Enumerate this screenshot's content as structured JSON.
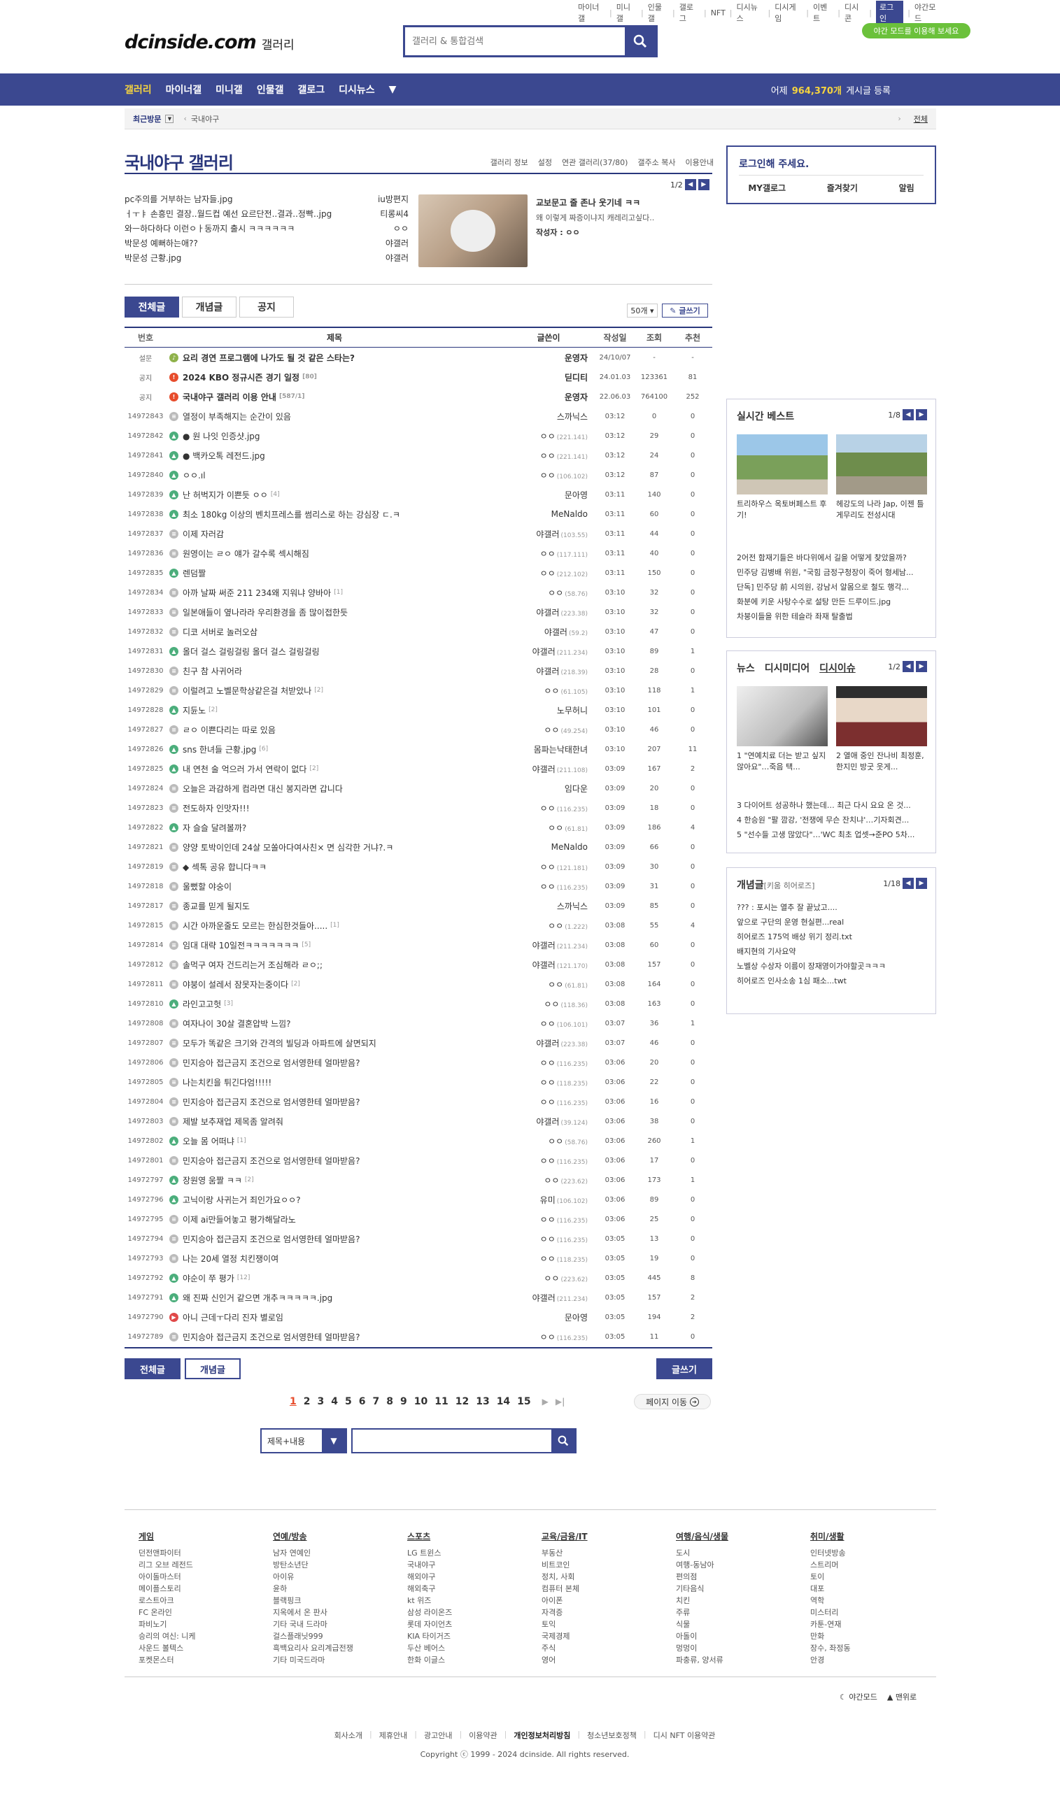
{
  "top_links": [
    "마이너갤",
    "미니갤",
    "인물갤",
    "갤로그",
    "NFT",
    "디시뉴스",
    "디시게임",
    "이벤트",
    "디시콘",
    "로그인",
    "야간모드"
  ],
  "night_banner": "야간 모드를 이용해 보세요",
  "logo": {
    "wordmark": "dcinside.com",
    "gallery": "갤러리"
  },
  "search": {
    "placeholder": "갤러리 & 통합검색"
  },
  "gnb": {
    "items": [
      "갤러리",
      "마이너갤",
      "미니갤",
      "인물갤",
      "갤로그",
      "디시뉴스"
    ],
    "count_prefix": "어제",
    "count_value": "964,370개",
    "count_suffix": "게시글 등록"
  },
  "visit": {
    "label": "최근방문",
    "current": "국내야구",
    "all": "전체"
  },
  "gallery": {
    "title": "국내야구 갤러리",
    "menu": [
      "갤러리 정보",
      "설정",
      "연관 갤러리(37/80)",
      "갤주소 복사",
      "이용안내"
    ]
  },
  "hot": {
    "page": "1/2",
    "rows": [
      {
        "title": "pc주의를 거부하는 남자들.jpg",
        "writer": "iu방편지"
      },
      {
        "title": "ㅓㅜㅑ 손흥민 결장..월드컵 예선 요르단전..결과..정빡..jpg",
        "writer": "티롱씨4"
      },
      {
        "title": "와ㅡ하다하다 이런ㅇㅏ동까지 출시 ㅋㅋㅋㅋㅋㅋ",
        "writer": "ㅇㅇ"
      },
      {
        "title": "박문성 예뻐하는애??",
        "writer": "야갤러"
      },
      {
        "title": "박문성 근황.jpg",
        "writer": "야갤러"
      }
    ],
    "featured_title": "교보문고 줄 존나 웃기네 ㅋㅋ",
    "featured_sub": "왜 이렇게 짜증이냐지 캐레리고싶다..",
    "featured_writer": "작성자 : ㅇㅇ"
  },
  "tabs": [
    "전체글",
    "개념글",
    "공지"
  ],
  "list_ctrl": {
    "per_page": "50개",
    "write": "글쓰기"
  },
  "table_head": [
    "번호",
    "제목",
    "글쓴이",
    "작성일",
    "조회",
    "추천"
  ],
  "posts": [
    {
      "num": "설문",
      "icon": "speaker",
      "title": "요리 경연 프로그램에 나가도 될 것 같은 스타는?",
      "cmt": "",
      "writer": "운영자",
      "ip": "",
      "date": "24/10/07",
      "views": "-",
      "rec": "-",
      "notice": true
    },
    {
      "num": "공지",
      "icon": "notice",
      "title": "2024 KBO 정규시즌 경기 일정",
      "cmt": "[80]",
      "writer": "딛디티",
      "ip": "",
      "date": "24.01.03",
      "views": "123361",
      "rec": "81",
      "notice": true
    },
    {
      "num": "공지",
      "icon": "notice",
      "title": "국내야구 갤러리 이용 안내",
      "cmt": "[587/1]",
      "writer": "운영자",
      "ip": "",
      "date": "22.06.03",
      "views": "764100",
      "rec": "252",
      "notice": true
    },
    {
      "num": "14972843",
      "icon": "txt",
      "title": "열정이 부족해지는 순간이 있음",
      "cmt": "",
      "writer": "스까닉스",
      "ip": "",
      "date": "03:12",
      "views": "0",
      "rec": "0"
    },
    {
      "num": "14972842",
      "icon": "img",
      "title": "● 원 나잇 인증샷.jpg",
      "cmt": "",
      "writer": "ㅇㅇ",
      "ip": "(221.141)",
      "date": "03:12",
      "views": "29",
      "rec": "0"
    },
    {
      "num": "14972841",
      "icon": "img",
      "title": "● 백카오톡 레전드.jpg",
      "cmt": "",
      "writer": "ㅇㅇ",
      "ip": "(221.141)",
      "date": "03:12",
      "views": "24",
      "rec": "0"
    },
    {
      "num": "14972840",
      "icon": "img",
      "title": "ㅇㅇ.ıl",
      "cmt": "",
      "writer": "ㅇㅇ",
      "ip": "(106.102)",
      "date": "03:12",
      "views": "87",
      "rec": "0"
    },
    {
      "num": "14972839",
      "icon": "img",
      "title": "난 허벅지가 이쁜듯 ㅇㅇ",
      "cmt": "[4]",
      "writer": "문아영",
      "ip": "",
      "date": "03:11",
      "views": "140",
      "rec": "0"
    },
    {
      "num": "14972838",
      "icon": "img",
      "title": "최소 180kg 이상의 벤치프레스를 썸리스로 하는 강심장 ㄷ.ㅋ",
      "cmt": "",
      "writer": "MeNaldo",
      "ip": "",
      "date": "03:11",
      "views": "60",
      "rec": "0"
    },
    {
      "num": "14972837",
      "icon": "txt",
      "title": "이제 자러감",
      "cmt": "",
      "writer": "야갤러",
      "ip": "(103.55)",
      "date": "03:11",
      "views": "44",
      "rec": "0"
    },
    {
      "num": "14972836",
      "icon": "txt",
      "title": "원영이는 ㄹㅇ 얘가 갈수록 섹시해짐",
      "cmt": "",
      "writer": "ㅇㅇ",
      "ip": "(117.111)",
      "date": "03:11",
      "views": "40",
      "rec": "0"
    },
    {
      "num": "14972835",
      "icon": "img",
      "title": "렌덤짤",
      "cmt": "",
      "writer": "ㅇㅇ",
      "ip": "(212.102)",
      "date": "03:11",
      "views": "150",
      "rec": "0"
    },
    {
      "num": "14972834",
      "icon": "txt",
      "title": "아까 날짜 써준 211 234왜 지워냐 양바아",
      "cmt": "[1]",
      "writer": "ㅇㅇ",
      "ip": "(58.76)",
      "date": "03:10",
      "views": "32",
      "rec": "0"
    },
    {
      "num": "14972833",
      "icon": "txt",
      "title": "일본애들이 옆나라라 우리환경을 좀 많이접한듯",
      "cmt": "",
      "writer": "야갤러",
      "ip": "(223.38)",
      "date": "03:10",
      "views": "32",
      "rec": "0"
    },
    {
      "num": "14972832",
      "icon": "txt",
      "title": "디코 서버로 놀러오삼",
      "cmt": "",
      "writer": "야갤러",
      "ip": "(59.2)",
      "date": "03:10",
      "views": "47",
      "rec": "0"
    },
    {
      "num": "14972831",
      "icon": "img",
      "title": "올더 걸스 걸링걸링 올더 걸스 걸링걸링",
      "cmt": "",
      "writer": "야갤러",
      "ip": "(211.234)",
      "date": "03:10",
      "views": "89",
      "rec": "1"
    },
    {
      "num": "14972830",
      "icon": "txt",
      "title": "친구 참 사귀어라",
      "cmt": "",
      "writer": "야갤러",
      "ip": "(218.39)",
      "date": "03:10",
      "views": "28",
      "rec": "0"
    },
    {
      "num": "14972829",
      "icon": "txt",
      "title": "이럴려고 노벨문학상같은걸 처받았나",
      "cmt": "[2]",
      "writer": "ㅇㅇ",
      "ip": "(61.105)",
      "date": "03:10",
      "views": "118",
      "rec": "1"
    },
    {
      "num": "14972828",
      "icon": "img",
      "title": "지듄노",
      "cmt": "[2]",
      "writer": "노무허니",
      "ip": "",
      "date": "03:10",
      "views": "101",
      "rec": "0"
    },
    {
      "num": "14972827",
      "icon": "txt",
      "title": "ㄹㅇ 이쁜다리는 따로 있음",
      "cmt": "",
      "writer": "ㅇㅇ",
      "ip": "(49.254)",
      "date": "03:10",
      "views": "46",
      "rec": "0"
    },
    {
      "num": "14972826",
      "icon": "img",
      "title": "sns 한녀들 근황.jpg",
      "cmt": "[6]",
      "writer": "몸파는낙태한녀",
      "ip": "",
      "date": "03:10",
      "views": "207",
      "rec": "11"
    },
    {
      "num": "14972825",
      "icon": "img",
      "title": "내 연천 술 억으러 가서 연락이 없다",
      "cmt": "[2]",
      "writer": "야갤러",
      "ip": "(211.108)",
      "date": "03:09",
      "views": "167",
      "rec": "2"
    },
    {
      "num": "14972824",
      "icon": "txt",
      "title": "오늘은 과감하게 컴라면 대신 봉지라면 갑니다",
      "cmt": "",
      "writer": "임다운",
      "ip": "",
      "date": "03:09",
      "views": "20",
      "rec": "0"
    },
    {
      "num": "14972823",
      "icon": "txt",
      "title": "전도하자 인맛자!!!",
      "cmt": "",
      "writer": "ㅇㅇ",
      "ip": "(116.235)",
      "date": "03:09",
      "views": "18",
      "rec": "0"
    },
    {
      "num": "14972822",
      "icon": "img",
      "title": "자 슬슬 달려볼까?",
      "cmt": "",
      "writer": "ㅇㅇ",
      "ip": "(61.81)",
      "date": "03:09",
      "views": "186",
      "rec": "4"
    },
    {
      "num": "14972821",
      "icon": "txt",
      "title": "양양 토박이인데 24살 모쏠아다여사친× 면 심각한 거냐?.ㅋ",
      "cmt": "",
      "writer": "MeNaldo",
      "ip": "",
      "date": "03:09",
      "views": "66",
      "rec": "0"
    },
    {
      "num": "14972819",
      "icon": "txt",
      "title": "◆ 섹톡 공유 합니다ㅋㅋ",
      "cmt": "",
      "writer": "ㅇㅇ",
      "ip": "(121.181)",
      "date": "03:09",
      "views": "30",
      "rec": "0"
    },
    {
      "num": "14972818",
      "icon": "txt",
      "title": "울뻤할 야숭이",
      "cmt": "",
      "writer": "ㅇㅇ",
      "ip": "(116.235)",
      "date": "03:09",
      "views": "31",
      "rec": "0"
    },
    {
      "num": "14972817",
      "icon": "txt",
      "title": "종교를 믿게 될지도",
      "cmt": "",
      "writer": "스까닉스",
      "ip": "",
      "date": "03:09",
      "views": "85",
      "rec": "0"
    },
    {
      "num": "14972815",
      "icon": "txt",
      "title": "시간 아까운줄도 모르는 한심한것들아.....",
      "cmt": "[1]",
      "writer": "ㅇㅇ",
      "ip": "(1.222)",
      "date": "03:08",
      "views": "55",
      "rec": "4"
    },
    {
      "num": "14972814",
      "icon": "txt",
      "title": "임대 대략 10일전ㅋㅋㅋㅋㅋㅋㅋ",
      "cmt": "[5]",
      "writer": "야갤러",
      "ip": "(211.234)",
      "date": "03:08",
      "views": "60",
      "rec": "0"
    },
    {
      "num": "14972812",
      "icon": "txt",
      "title": "솔먹구 여자 건드리는거 조심해라 ㄹㅇ;;",
      "cmt": "",
      "writer": "야갤러",
      "ip": "(121.170)",
      "date": "03:08",
      "views": "157",
      "rec": "0"
    },
    {
      "num": "14972811",
      "icon": "txt",
      "title": "야붕이 설레서 잠못자는중이다",
      "cmt": "[2]",
      "writer": "ㅇㅇ",
      "ip": "(61.81)",
      "date": "03:08",
      "views": "164",
      "rec": "0"
    },
    {
      "num": "14972810",
      "icon": "img",
      "title": "라인고고헛",
      "cmt": "[3]",
      "writer": "ㅇㅇ",
      "ip": "(118.36)",
      "date": "03:08",
      "views": "163",
      "rec": "0"
    },
    {
      "num": "14972808",
      "icon": "txt",
      "title": "여자나이 30살 결혼압박 느낌?",
      "cmt": "",
      "writer": "ㅇㅇ",
      "ip": "(106.101)",
      "date": "03:07",
      "views": "36",
      "rec": "1"
    },
    {
      "num": "14972807",
      "icon": "txt",
      "title": "모두가 똑같은 크기와 간격의 빌딩과 아파트에 살면되지",
      "cmt": "",
      "writer": "야갤러",
      "ip": "(223.38)",
      "date": "03:07",
      "views": "46",
      "rec": "0"
    },
    {
      "num": "14972806",
      "icon": "txt",
      "title": "민지승아 접근금지 조건으로 엄서영한테 얼마받음?",
      "cmt": "",
      "writer": "ㅇㅇ",
      "ip": "(116.235)",
      "date": "03:06",
      "views": "20",
      "rec": "0"
    },
    {
      "num": "14972805",
      "icon": "txt",
      "title": "나는치킨을 튀긴다엄!!!!!",
      "cmt": "",
      "writer": "ㅇㅇ",
      "ip": "(118.235)",
      "date": "03:06",
      "views": "22",
      "rec": "0"
    },
    {
      "num": "14972804",
      "icon": "txt",
      "title": "민지승아 접근금지 조건으로 엄서영한테 얼마받음?",
      "cmt": "",
      "writer": "ㅇㅇ",
      "ip": "(116.235)",
      "date": "03:06",
      "views": "16",
      "rec": "0"
    },
    {
      "num": "14972803",
      "icon": "txt",
      "title": "제발 보추재업 제목좀 알려줘",
      "cmt": "",
      "writer": "야갤러",
      "ip": "(39.124)",
      "date": "03:06",
      "views": "38",
      "rec": "0"
    },
    {
      "num": "14972802",
      "icon": "img",
      "title": "오늘 몸 어떠냐",
      "cmt": "[1]",
      "writer": "ㅇㅇ",
      "ip": "(58.76)",
      "date": "03:06",
      "views": "260",
      "rec": "1"
    },
    {
      "num": "14972801",
      "icon": "txt",
      "title": "민지승아 접근금지 조건으로 엄서영한테 얼마받음?",
      "cmt": "",
      "writer": "ㅇㅇ",
      "ip": "(116.235)",
      "date": "03:06",
      "views": "17",
      "rec": "0"
    },
    {
      "num": "14972797",
      "icon": "img",
      "title": "장원영 움짤 ㅋㅋ",
      "cmt": "[2]",
      "writer": "ㅇㅇ",
      "ip": "(223.62)",
      "date": "03:06",
      "views": "173",
      "rec": "1"
    },
    {
      "num": "14972796",
      "icon": "img",
      "title": "고닉이랑 사귀는거 죄인가요ㅇㅇ?",
      "cmt": "",
      "writer": "유미",
      "ip": "(106.102)",
      "date": "03:06",
      "views": "89",
      "rec": "0"
    },
    {
      "num": "14972795",
      "icon": "txt",
      "title": "이제 ai만들어놓고 평가해달라노",
      "cmt": "",
      "writer": "ㅇㅇ",
      "ip": "(116.235)",
      "date": "03:06",
      "views": "25",
      "rec": "0"
    },
    {
      "num": "14972794",
      "icon": "txt",
      "title": "민지승아 접근금지 조건으로 엄서영한테 얼마받음?",
      "cmt": "",
      "writer": "ㅇㅇ",
      "ip": "(116.235)",
      "date": "03:05",
      "views": "13",
      "rec": "0"
    },
    {
      "num": "14972793",
      "icon": "txt",
      "title": "나는 20세 열정 치킨쟁이여",
      "cmt": "",
      "writer": "ㅇㅇ",
      "ip": "(118.235)",
      "date": "03:05",
      "views": "19",
      "rec": "0"
    },
    {
      "num": "14972792",
      "icon": "img",
      "title": "야순이 쭈 평가",
      "cmt": "[12]",
      "writer": "ㅇㅇ",
      "ip": "(223.62)",
      "date": "03:05",
      "views": "445",
      "rec": "8"
    },
    {
      "num": "14972791",
      "icon": "img",
      "title": "왜 진짜 신인거 같으면 개추ㅋㅋㅋㅋㅋ.jpg",
      "cmt": "",
      "writer": "야갤러",
      "ip": "(211.234)",
      "date": "03:05",
      "views": "157",
      "rec": "2"
    },
    {
      "num": "14972790",
      "icon": "vid",
      "title": "아니 근데ㅜ다리 진자 별로임",
      "cmt": "",
      "writer": "문아영",
      "ip": "",
      "date": "03:05",
      "views": "194",
      "rec": "2"
    },
    {
      "num": "14972789",
      "icon": "txt",
      "title": "민지승아 접근금지 조건으로 엄서영한테 얼마받음?",
      "cmt": "",
      "writer": "ㅇㅇ",
      "ip": "(116.235)",
      "date": "03:05",
      "views": "11",
      "rec": "0"
    }
  ],
  "bottom_btns": {
    "all": "전체글",
    "concept": "개념글",
    "write": "글쓰기"
  },
  "paging": [
    "1",
    "2",
    "3",
    "4",
    "5",
    "6",
    "7",
    "8",
    "9",
    "10",
    "11",
    "12",
    "13",
    "14",
    "15"
  ],
  "page_go": "페이지 이동",
  "bottom_search": {
    "select": "제목+내용"
  },
  "login": {
    "title": "로그인해 주세요.",
    "links": [
      "MY갤로그",
      "즐겨찾기",
      "알림"
    ]
  },
  "best": {
    "title": "실시간 베스트",
    "page": "1/8",
    "caps": [
      "트리하우스 옥토버페스트 후기!",
      "헤강도의 나라 Jap, 이젠 틀게무리도 전성시대"
    ],
    "list": [
      "2어전 함재기들은 바다위에서 길을 어떻게 찾았을까?",
      "민주당 김병배 위원, \"국힘 금정구청장이 죽어 형세남...",
      "단독] 민주당 前 시의원, 강남서 알몸으로 철도 행각...",
      "화분에 키운 사탕수수로 설탕 만든 드루이드.jpg",
      "차붕이들을 위한 테슬라 좌재 탈출법"
    ]
  },
  "news": {
    "tabs": [
      "뉴스",
      "디시미디어",
      "디시이슈"
    ],
    "page": "1/2",
    "caps": [
      "1 \"연예치료 더는 받고 싶지 않아요\"…죽음 택...",
      "2 열애 중인 잔나비 최정훈, 한지민 방굿 웃게..."
    ],
    "list": [
      "3 다이어트 성공하나 했는데… 최근 다시 요요 온 것...",
      "4 한승원 \"팔 깜강, '전쟁에 무슨 잔치냐'…기자회견...",
      "5 \"선수들 고생 많았다\"…'WC 최초 업셋→준PO 5차..."
    ]
  },
  "concept": {
    "title": "개념글",
    "sub": "[키움 히어로즈]",
    "page": "1/18",
    "list": [
      "??? : 포시는 열추 잘 끝났고....",
      "앞으로 구단의 운영 현실편...real",
      "히어로즈 175억 배상 위기 정리.txt",
      "배지현의 기사요약",
      "노벨상 수상자 이름이 장재영이가야할곳ㅋㅋㅋ",
      "히어로즈 인사소송 1심 패소...twt"
    ]
  },
  "footer": {
    "cols": [
      {
        "h": "게임",
        "items": [
          "던전앤파이터",
          "리그 오브 레전드",
          "아이돌마스터",
          "메이플스토리",
          "로스트아크",
          "FC 온라인",
          "파비노기",
          "승리의 여신: 니케",
          "사운드 볼텍스",
          "포켓몬스터"
        ]
      },
      {
        "h": "연예/방송",
        "items": [
          "남자 연예인",
          "방탄소년단",
          "아이유",
          "윤하",
          "블랙핑크",
          "지옥에서 온 판사",
          "기타 국내 드라마",
          "걸스플래닛999",
          "흑백요리사 요리계급전쟁",
          "기타 미국드라마"
        ]
      },
      {
        "h": "스포츠",
        "items": [
          "LG 트윈스",
          "국내야구",
          "해외야구",
          "해외축구",
          "kt 위즈",
          "삼성 라이온즈",
          "롯데 자이언츠",
          "KIA 타이거즈",
          "두산 베어스",
          "한화 이글스"
        ]
      },
      {
        "h": "교육/금융/IT",
        "items": [
          "부동산",
          "비트코인",
          "정치, 사회",
          "컴퓨터 본체",
          "아이폰",
          "자격증",
          "토익",
          "국제경제",
          "주식",
          "영어"
        ]
      },
      {
        "h": "여행/음식/생물",
        "items": [
          "도시",
          "여행-동남아",
          "편의점",
          "기타음식",
          "치킨",
          "주류",
          "식물",
          "아돌이",
          "멍멍이",
          "파충류, 양서류"
        ]
      },
      {
        "h": "취미/생활",
        "items": [
          "인터넷방송",
          "스트리머",
          "토이",
          "대포",
          "역학",
          "미스터리",
          "카툰-연재",
          "만화",
          "장수, 좌정동",
          "안경"
        ]
      }
    ],
    "bottom": [
      "야간모드",
      "맨위로"
    ],
    "links": [
      "회사소개",
      "제휴안내",
      "광고안내",
      "이용약관",
      "개인정보처리방침",
      "청소년보호정책",
      "디시 NFT 이용약관"
    ],
    "copyright": "Copyright ⓒ 1999 - 2024 dcinside. All rights reserved."
  }
}
